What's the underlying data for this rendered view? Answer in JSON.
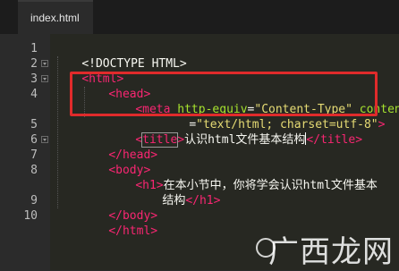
{
  "tab": {
    "filename": "index.html"
  },
  "line_numbers": [
    "1",
    "2",
    "3",
    "4",
    "",
    "5",
    "6",
    "7",
    "8",
    "",
    "9",
    "10"
  ],
  "code": {
    "l1": {
      "text": "<!DOCTYPE HTML>"
    },
    "l2": {
      "open": "<html>"
    },
    "l3": {
      "open": "<head>"
    },
    "l4": {
      "tag_open": "<meta",
      "attr1": " http-equiv",
      "eq1": "=",
      "val1": "\"Content-Type\"",
      "attr2": " content",
      "eq2": "=",
      "val2": "\"text/html; charset=utf-8\"",
      "tag_close": ">"
    },
    "l5": {
      "open_lt": "<",
      "title_tag": "title",
      "open_gt": ">",
      "text_before_cursor": "认识html文件基本结构",
      "close_tag": "</title>"
    },
    "l6": {
      "close": "</head>"
    },
    "l7": {
      "open": "<body>"
    },
    "l8": {
      "open": "<h1>",
      "text_line1": "在本小节中，你将学会认识html文件基本",
      "text_line2": "结构",
      "close": "</h1>"
    },
    "l9": {
      "close": "</body>"
    },
    "l10": {
      "close": "</html>"
    }
  },
  "watermark": {
    "text": "广西龙网"
  },
  "colors": {
    "tag": "#f92672",
    "attribute": "#a6e22e",
    "string": "#e6db74",
    "highlight_box": "#e02b2b",
    "editor_bg": "#272822"
  }
}
